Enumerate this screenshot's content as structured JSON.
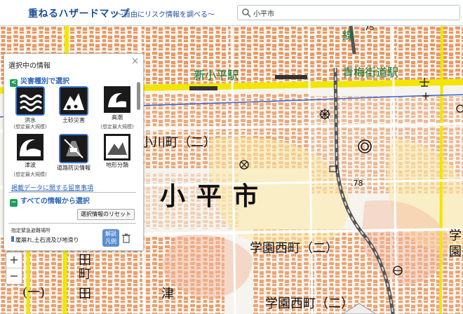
{
  "header": {
    "title": "重ねるハザードマップ",
    "subtitle": "～自由にリスク情報を調べる～",
    "search_value": "小平市"
  },
  "map": {
    "labels": {
      "station_kodaira": "新小平駅",
      "station_oume": "青梅街道駅",
      "line_name": "線",
      "elev_top": ".75",
      "elev_mid": ".78",
      "town_ogawa": "小川町（二）",
      "big_kodaira": "小平市",
      "town_gakuen1": "学園西町（二）",
      "town_gakuen2": "学園西町（二）",
      "town_gakuen_edge": "学",
      "town_gakuen_edge2": "園",
      "town_ta": "田",
      "town_cho": "町",
      "town_ichi": "(一)",
      "town_tsu": "津",
      "town_tamachi": "田"
    }
  },
  "zoom": {
    "in": "+",
    "out": "−"
  },
  "panel": {
    "title": "選択中の情報",
    "close": "×",
    "section_hazard": "災害種別で選択",
    "hazards": [
      {
        "label": "洪水",
        "sub": "(想定最大規模)"
      },
      {
        "label": "土砂災害",
        "sub": ""
      },
      {
        "label": "高潮",
        "sub": "(想定最大規模)"
      },
      {
        "label": "津波",
        "sub": "(想定最大規模)"
      },
      {
        "label": "道路防災情報",
        "sub": ""
      },
      {
        "label": "地形分類",
        "sub": ""
      }
    ],
    "caution_link": "掲載データに関する留意事項",
    "section_all": "すべての情報から選択",
    "reset_button": "選択情報のリセット",
    "legend_title": "指定緊急避難場所",
    "legend_item": "崖崩れ,土石流及び地滑り",
    "legend_button": "解説\n凡例"
  },
  "colors": {
    "accent": "#1d4f99",
    "station": "#0e7a3a",
    "road": "#f2e600",
    "building": "#e8894a"
  }
}
